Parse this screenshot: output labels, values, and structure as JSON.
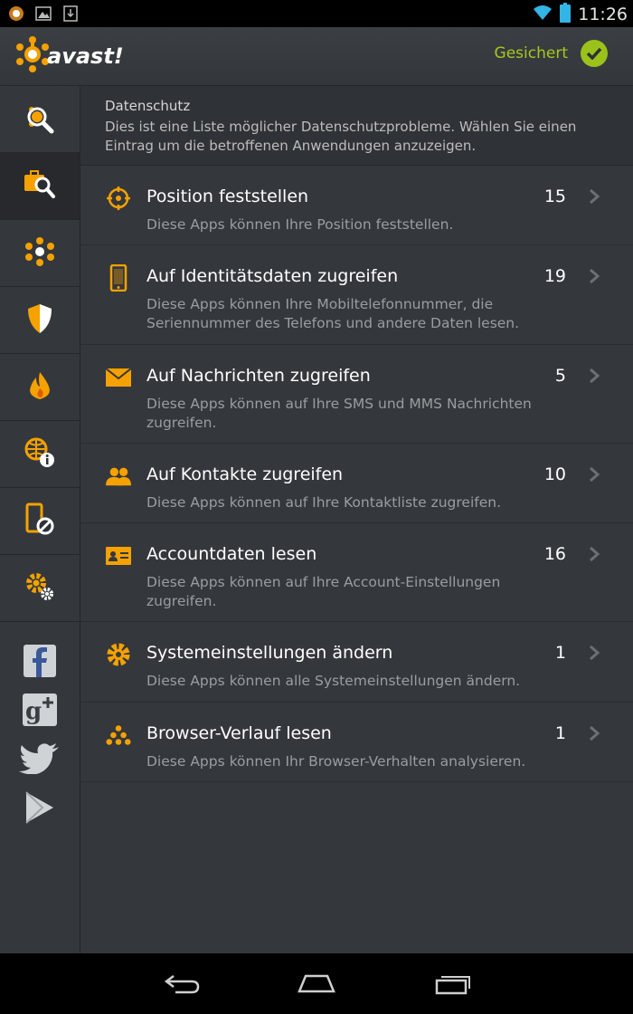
{
  "status_bar": {
    "time": "11:26",
    "icons": [
      "avast-notification-icon",
      "image-icon",
      "download-icon",
      "wifi-icon",
      "battery-icon"
    ]
  },
  "header": {
    "logo_text": "avast!",
    "status_label": "Gesichert",
    "status_icon": "check-icon",
    "accent_color": "#f5a100",
    "status_color": "#9bc21b"
  },
  "sidebar": {
    "items": [
      {
        "icon": "scan-icon",
        "active": false
      },
      {
        "icon": "privacy-advisor-icon",
        "active": true
      },
      {
        "icon": "network-icon",
        "active": false
      },
      {
        "icon": "shield-icon",
        "active": false
      },
      {
        "icon": "firewall-icon",
        "active": false
      },
      {
        "icon": "web-info-icon",
        "active": false
      },
      {
        "icon": "anti-theft-icon",
        "active": false
      },
      {
        "icon": "settings-icon",
        "active": false
      }
    ],
    "social": [
      "facebook-icon",
      "google-plus-icon",
      "twitter-icon",
      "play-store-icon"
    ]
  },
  "main": {
    "intro_title": "Datenschutz",
    "intro_text": "Dies ist eine Liste möglicher Datenschutzprobleme. Wählen Sie einen Eintrag um die betroffenen Anwendungen anzuzeigen.",
    "rows": [
      {
        "icon": "location-target-icon",
        "title": "Position feststellen",
        "count": "15",
        "desc": "Diese Apps können Ihre Position feststellen."
      },
      {
        "icon": "phone-icon",
        "title": "Auf Identitätsdaten zugreifen",
        "count": "19",
        "desc": "Diese Apps können Ihre Mobiltelefonnummer, die Seriennummer des Telefons und andere Daten lesen."
      },
      {
        "icon": "envelope-icon",
        "title": "Auf Nachrichten zugreifen",
        "count": "5",
        "desc": "Diese Apps können auf Ihre SMS und MMS Nachrichten zugreifen."
      },
      {
        "icon": "contacts-icon",
        "title": "Auf Kontakte zugreifen",
        "count": "10",
        "desc": "Diese Apps können auf Ihre Kontaktliste zugreifen."
      },
      {
        "icon": "account-card-icon",
        "title": "Accountdaten lesen",
        "count": "16",
        "desc": "Diese Apps können auf Ihre Account-Einstellungen zugreifen."
      },
      {
        "icon": "gear-icon",
        "title": "Systemeinstellungen ändern",
        "count": "1",
        "desc": "Diese Apps können alle Systemeinstellungen ändern."
      },
      {
        "icon": "browser-history-icon",
        "title": "Browser-Verlauf lesen",
        "count": "1",
        "desc": "Diese Apps können Ihr Browser-Verhalten analysieren."
      }
    ]
  },
  "nav_bar": {
    "buttons": [
      "back-icon",
      "home-icon",
      "recent-apps-icon"
    ]
  }
}
